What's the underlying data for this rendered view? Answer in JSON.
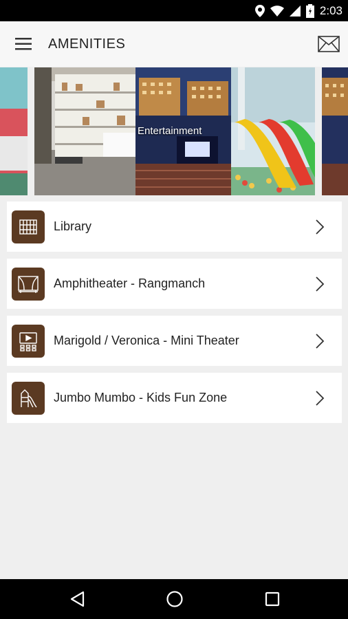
{
  "status_bar": {
    "time": "2:03"
  },
  "app_bar": {
    "title": "AMENITIES"
  },
  "carousel": {
    "caption": "Entertainment"
  },
  "amenities": [
    {
      "label": "Library",
      "icon": "library-icon"
    },
    {
      "label": "Amphitheater - Rangmanch",
      "icon": "theater-stage-icon"
    },
    {
      "label": "Marigold / Veronica - Mini Theater",
      "icon": "mini-theater-icon"
    },
    {
      "label": "Jumbo Mumbo - Kids Fun Zone",
      "icon": "slide-playground-icon"
    }
  ],
  "colors": {
    "icon_bg": "#5b3a22",
    "status_bar": "#000000",
    "app_bar": "#f7f7f7",
    "background": "#efefef"
  }
}
